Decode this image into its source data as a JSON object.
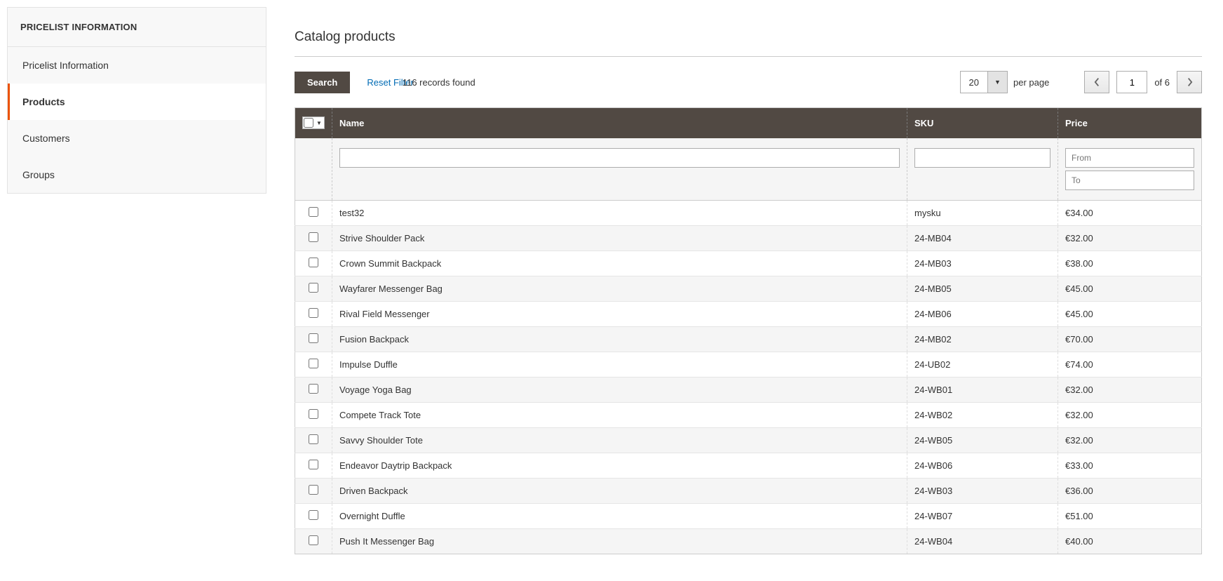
{
  "sidebar": {
    "header": "PRICELIST INFORMATION",
    "items": [
      {
        "label": "Pricelist Information"
      },
      {
        "label": "Products"
      },
      {
        "label": "Customers"
      },
      {
        "label": "Groups"
      }
    ],
    "activeIndex": 1
  },
  "main": {
    "title": "Catalog products",
    "search_label": "Search",
    "reset_label": "Reset Filter",
    "records_found": "116 records found",
    "per_page": {
      "value": "20",
      "label": "per page"
    },
    "pager": {
      "current": "1",
      "of_label": "of 6"
    },
    "columns": {
      "name": "Name",
      "sku": "SKU",
      "price": "Price"
    },
    "filters": {
      "price_from_placeholder": "From",
      "price_to_placeholder": "To"
    },
    "rows": [
      {
        "name": "test32",
        "sku": "mysku",
        "price": "€34.00"
      },
      {
        "name": "Strive Shoulder Pack",
        "sku": "24-MB04",
        "price": "€32.00"
      },
      {
        "name": "Crown Summit Backpack",
        "sku": "24-MB03",
        "price": "€38.00"
      },
      {
        "name": "Wayfarer Messenger Bag",
        "sku": "24-MB05",
        "price": "€45.00"
      },
      {
        "name": "Rival Field Messenger",
        "sku": "24-MB06",
        "price": "€45.00"
      },
      {
        "name": "Fusion Backpack",
        "sku": "24-MB02",
        "price": "€70.00"
      },
      {
        "name": "Impulse Duffle",
        "sku": "24-UB02",
        "price": "€74.00"
      },
      {
        "name": "Voyage Yoga Bag",
        "sku": "24-WB01",
        "price": "€32.00"
      },
      {
        "name": "Compete Track Tote",
        "sku": "24-WB02",
        "price": "€32.00"
      },
      {
        "name": "Savvy Shoulder Tote",
        "sku": "24-WB05",
        "price": "€32.00"
      },
      {
        "name": "Endeavor Daytrip Backpack",
        "sku": "24-WB06",
        "price": "€33.00"
      },
      {
        "name": "Driven Backpack",
        "sku": "24-WB03",
        "price": "€36.00"
      },
      {
        "name": "Overnight Duffle",
        "sku": "24-WB07",
        "price": "€51.00"
      },
      {
        "name": "Push It Messenger Bag",
        "sku": "24-WB04",
        "price": "€40.00"
      }
    ]
  }
}
